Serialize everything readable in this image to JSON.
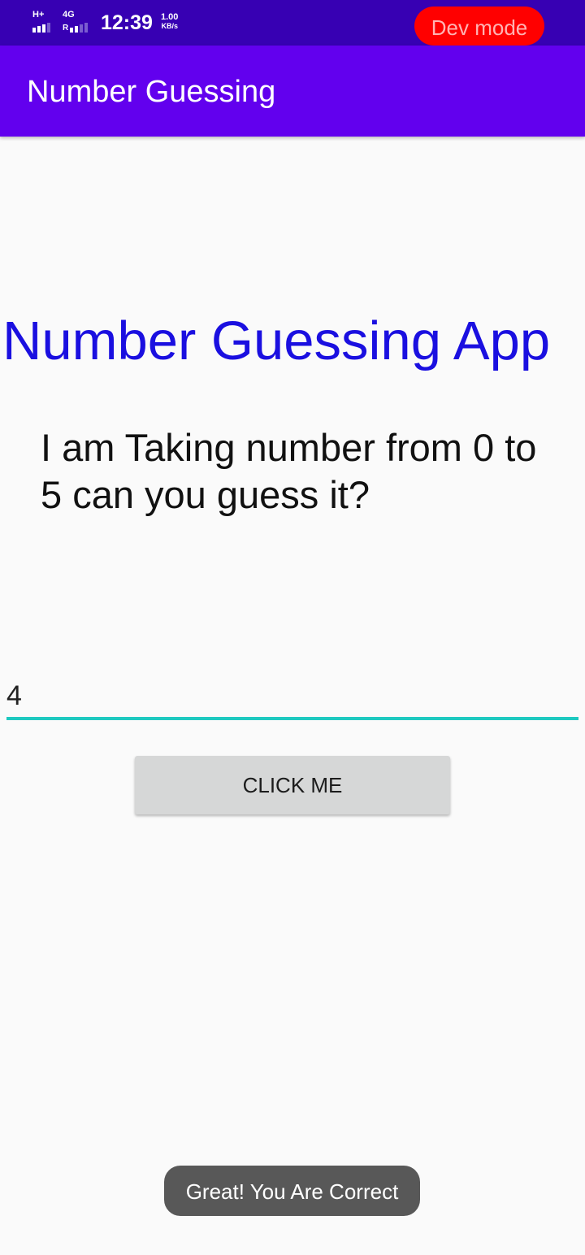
{
  "status_bar": {
    "sim1_type": "H+",
    "sim2_type": "4G",
    "sim2_roaming": "R",
    "time": "12:39",
    "net_speed_value": "1.00",
    "net_speed_unit": "KB/s",
    "dev_mode_label": "Dev mode",
    "dev_mode_color": "#ff0000",
    "color": "#3700b3",
    "icons": [
      "signal-icon",
      "signal-icon"
    ]
  },
  "app_bar": {
    "title": "Number Guessing",
    "color": "#6200ee"
  },
  "main": {
    "app_title": "Number Guessing App",
    "app_title_color": "#1a0fe0",
    "prompt": "I am Taking number from 0 to 5 can you guess it?",
    "guess_input_value": "4",
    "input_accent_color": "#1ec9c0",
    "button_label": "Click Me"
  },
  "toast": {
    "message": "Great! You Are Correct"
  }
}
